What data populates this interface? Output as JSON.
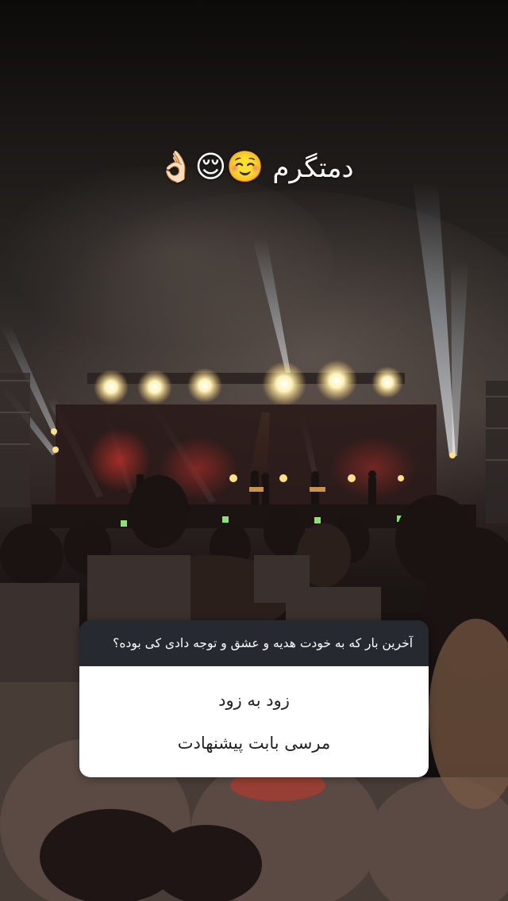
{
  "story": {
    "caption_text": "دمتگرم",
    "caption_emojis": "☺️😌👌🏻"
  },
  "question_sticker": {
    "question": "آخرین بار که به خودت هدیه و عشق و توجه دادی کی بوده؟",
    "answer_line_1": "زود به زود",
    "answer_line_2": "مرسی بابت پیشنهادت"
  },
  "colors": {
    "question_header_bg": "#262a30",
    "answer_bg": "#ffffff",
    "answer_text": "#222222",
    "stage_light": "#fff3c4",
    "beam": "#cfe6ff"
  }
}
